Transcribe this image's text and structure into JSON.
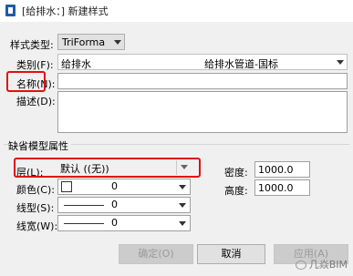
{
  "window": {
    "title": "[给排水：] 新建样式"
  },
  "style_type": {
    "label": "样式类型:",
    "value": "TriForma"
  },
  "category": {
    "label": "类别(F):",
    "value_left": "给排水",
    "value_right": "给排水管道-国标"
  },
  "name": {
    "label": "名称(N):",
    "value": ""
  },
  "description": {
    "label": "描述(D):",
    "value": ""
  },
  "default_props": {
    "section_title": "缺省模型属性",
    "layer": {
      "label": "层(L):",
      "value": "默认 ((无))"
    },
    "color": {
      "label": "颜色(C):",
      "value": "0"
    },
    "linetype": {
      "label": "线型(S):",
      "value": "0"
    },
    "lineweight": {
      "label": "线宽(W):",
      "value": "0"
    },
    "density": {
      "label": "密度:",
      "value": "1000.0"
    },
    "height": {
      "label": "高度:",
      "value": "1000.0"
    }
  },
  "buttons": {
    "ok": "确定(O)",
    "cancel": "取消",
    "apply": "应用(A)"
  },
  "watermark": {
    "text": "几焱BIM"
  },
  "colors": {
    "highlight": "#e01010",
    "app_icon": "#1e5aa8"
  }
}
